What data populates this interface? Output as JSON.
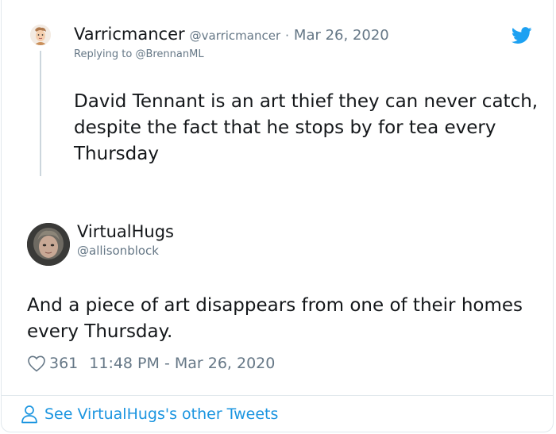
{
  "parent_tweet": {
    "name": "Varricmancer",
    "handle": "@varricmancer",
    "separator": "·",
    "date": "Mar 26, 2020",
    "replying_prefix": "Replying to",
    "replying_to": "@BrennanML",
    "text": "David Tennant is an art thief they can never catch, despite the fact that he stops by for tea every Thursday",
    "avatar_icon": "cartoon-avatar",
    "platform_icon": "twitter-bird-icon"
  },
  "main_tweet": {
    "name": "VirtualHugs",
    "handle": "@allisonblock",
    "text": "And a piece of art disappears from one of their homes every Thursday.",
    "like_count": "361",
    "timestamp": "11:48 PM - Mar 26, 2020",
    "avatar_icon": "photo-avatar"
  },
  "footer": {
    "link_text": "See VirtualHugs's other Tweets",
    "icon": "person-icon"
  },
  "colors": {
    "accent": "#1b95e0",
    "bird": "#1da1f2",
    "secondary_text": "#657786",
    "primary_text": "#14171a",
    "border": "#e1e8ed"
  }
}
